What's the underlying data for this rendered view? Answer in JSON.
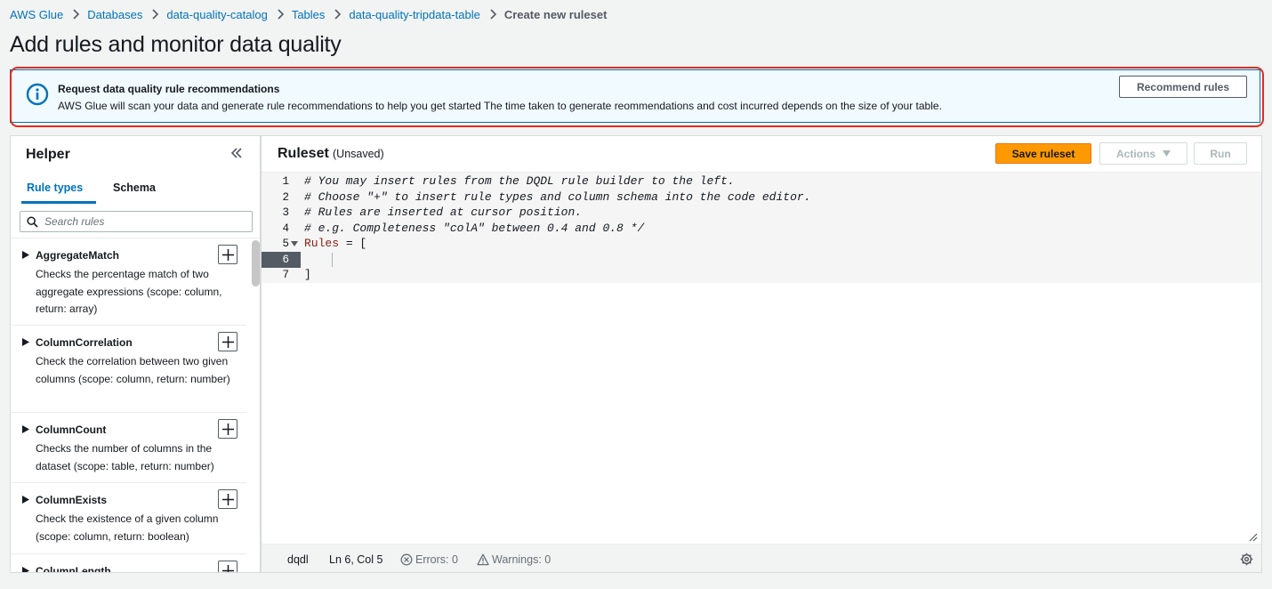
{
  "breadcrumb": {
    "items": [
      "AWS Glue",
      "Databases",
      "data-quality-catalog",
      "Tables",
      "data-quality-tripdata-table"
    ],
    "current": "Create new ruleset"
  },
  "page_title": "Add rules and monitor data quality",
  "alert": {
    "icon": "info-icon",
    "title": "Request data quality rule recommendations",
    "text": "AWS Glue will scan your data and generate rule recommendations to help you get started The time taken to generate reommendations and cost incurred depends on the size of your table.",
    "button_label": "Recommend rules"
  },
  "helper": {
    "title": "Helper",
    "collapse_icon": "double-chevron-left-icon",
    "tabs": [
      {
        "label": "Rule types",
        "active": true
      },
      {
        "label": "Schema",
        "active": false
      }
    ],
    "search": {
      "placeholder": "Search rules",
      "value": ""
    },
    "rules": [
      {
        "name": "AggregateMatch",
        "description": "Checks the percentage match of two aggregate expressions (scope: column, return: array)"
      },
      {
        "name": "ColumnCorrelation",
        "description": "Check the correlation between two given columns (scope: column, return: number)"
      },
      {
        "name": "ColumnCount",
        "description": "Checks the number of columns in the dataset (scope: table, return: number)"
      },
      {
        "name": "ColumnExists",
        "description": "Check the existence of a given column (scope: column, return: boolean)"
      },
      {
        "name": "ColumnLength",
        "description": ""
      }
    ]
  },
  "ruleset": {
    "title": "Ruleset",
    "status": "(Unsaved)",
    "save_label": "Save ruleset",
    "actions_label": "Actions",
    "run_label": "Run",
    "code_lines": [
      {
        "n": "1",
        "text": "# You may insert rules from the DQDL rule builder to the left."
      },
      {
        "n": "2",
        "text": "# Choose \"+\" to insert rule types and column schema into the code editor."
      },
      {
        "n": "3",
        "text": "# Rules are inserted at cursor position."
      },
      {
        "n": "4",
        "text": "# e.g. Completeness \"colA\" between 0.4 and 0.8 */"
      },
      {
        "n": "5",
        "keyword": "Rules",
        "rest": " = ["
      },
      {
        "n": "6",
        "text": ""
      },
      {
        "n": "7",
        "text": "]"
      }
    ],
    "status_bar": {
      "language": "dqdl",
      "position": "Ln 6, Col 5",
      "errors": "Errors: 0",
      "warnings": "Warnings: 0"
    }
  },
  "colors": {
    "link": "#0073bb",
    "primary_button": "#ff9900",
    "highlight_border": "#e02d1f",
    "alert_background": "#f1faff"
  }
}
